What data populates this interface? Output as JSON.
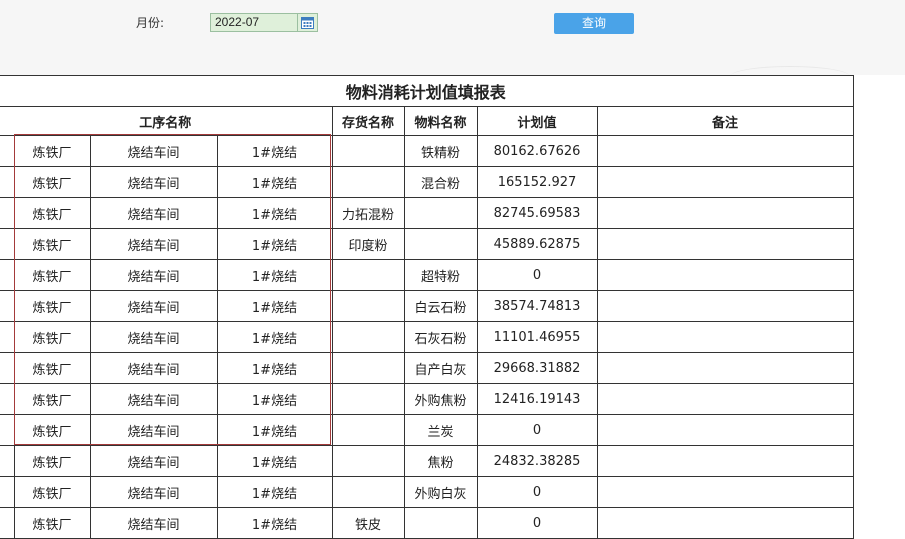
{
  "toolbar": {
    "month_label": "月份:",
    "month_value": "2022-07",
    "query_label": "查询"
  },
  "report": {
    "title": "物料消耗计划值填报表",
    "headers": {
      "process_name": "工序名称",
      "inventory_name": "存货名称",
      "material_name": "物料名称",
      "plan_value": "计划值",
      "remark": "备注"
    },
    "rows": [
      {
        "plant": "炼铁厂",
        "workshop": "烧结车间",
        "process": "1#烧结",
        "inventory": "",
        "material": "铁精粉",
        "plan": "80162.67626",
        "remark": ""
      },
      {
        "plant": "炼铁厂",
        "workshop": "烧结车间",
        "process": "1#烧结",
        "inventory": "",
        "material": "混合粉",
        "plan": "165152.927",
        "remark": ""
      },
      {
        "plant": "炼铁厂",
        "workshop": "烧结车间",
        "process": "1#烧结",
        "inventory": "力拓混粉",
        "material": "",
        "plan": "82745.69583",
        "remark": ""
      },
      {
        "plant": "炼铁厂",
        "workshop": "烧结车间",
        "process": "1#烧结",
        "inventory": "印度粉",
        "material": "",
        "plan": "45889.62875",
        "remark": ""
      },
      {
        "plant": "炼铁厂",
        "workshop": "烧结车间",
        "process": "1#烧结",
        "inventory": "",
        "material": "超特粉",
        "plan": "0",
        "remark": ""
      },
      {
        "plant": "炼铁厂",
        "workshop": "烧结车间",
        "process": "1#烧结",
        "inventory": "",
        "material": "白云石粉",
        "plan": "38574.74813",
        "remark": ""
      },
      {
        "plant": "炼铁厂",
        "workshop": "烧结车间",
        "process": "1#烧结",
        "inventory": "",
        "material": "石灰石粉",
        "plan": "11101.46955",
        "remark": ""
      },
      {
        "plant": "炼铁厂",
        "workshop": "烧结车间",
        "process": "1#烧结",
        "inventory": "",
        "material": "自产白灰",
        "plan": "29668.31882",
        "remark": ""
      },
      {
        "plant": "炼铁厂",
        "workshop": "烧结车间",
        "process": "1#烧结",
        "inventory": "",
        "material": "外购焦粉",
        "plan": "12416.19143",
        "remark": ""
      },
      {
        "plant": "炼铁厂",
        "workshop": "烧结车间",
        "process": "1#烧结",
        "inventory": "",
        "material": "兰炭",
        "plan": "0",
        "remark": ""
      },
      {
        "plant": "炼铁厂",
        "workshop": "烧结车间",
        "process": "1#烧结",
        "inventory": "",
        "material": "焦粉",
        "plan": "24832.38285",
        "remark": ""
      },
      {
        "plant": "炼铁厂",
        "workshop": "烧结车间",
        "process": "1#烧结",
        "inventory": "",
        "material": "外购白灰",
        "plan": "0",
        "remark": ""
      },
      {
        "plant": "炼铁厂",
        "workshop": "烧结车间",
        "process": "1#烧结",
        "inventory": "铁皮",
        "material": "",
        "plan": "0",
        "remark": ""
      }
    ]
  }
}
